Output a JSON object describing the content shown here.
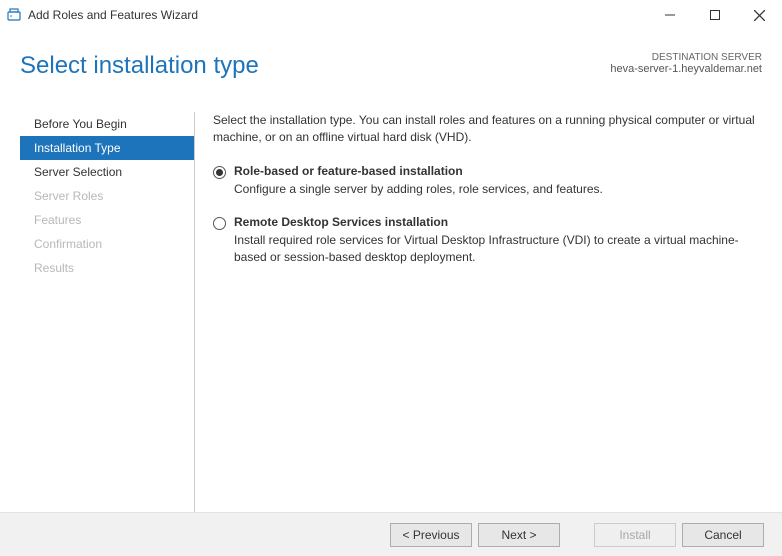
{
  "window": {
    "title": "Add Roles and Features Wizard"
  },
  "header": {
    "page_title": "Select installation type",
    "destination_label": "DESTINATION SERVER",
    "destination_server": "heva-server-1.heyvaldemar.net"
  },
  "sidebar": {
    "items": [
      {
        "label": "Before You Begin",
        "state": "enabled"
      },
      {
        "label": "Installation Type",
        "state": "active"
      },
      {
        "label": "Server Selection",
        "state": "enabled"
      },
      {
        "label": "Server Roles",
        "state": "disabled"
      },
      {
        "label": "Features",
        "state": "disabled"
      },
      {
        "label": "Confirmation",
        "state": "disabled"
      },
      {
        "label": "Results",
        "state": "disabled"
      }
    ]
  },
  "main": {
    "intro": "Select the installation type. You can install roles and features on a running physical computer or virtual machine, or on an offline virtual hard disk (VHD).",
    "options": [
      {
        "title": "Role-based or feature-based installation",
        "desc": "Configure a single server by adding roles, role services, and features.",
        "selected": true
      },
      {
        "title": "Remote Desktop Services installation",
        "desc": "Install required role services for Virtual Desktop Infrastructure (VDI) to create a virtual machine-based or session-based desktop deployment.",
        "selected": false
      }
    ]
  },
  "footer": {
    "previous": "< Previous",
    "next": "Next >",
    "install": "Install",
    "cancel": "Cancel"
  }
}
